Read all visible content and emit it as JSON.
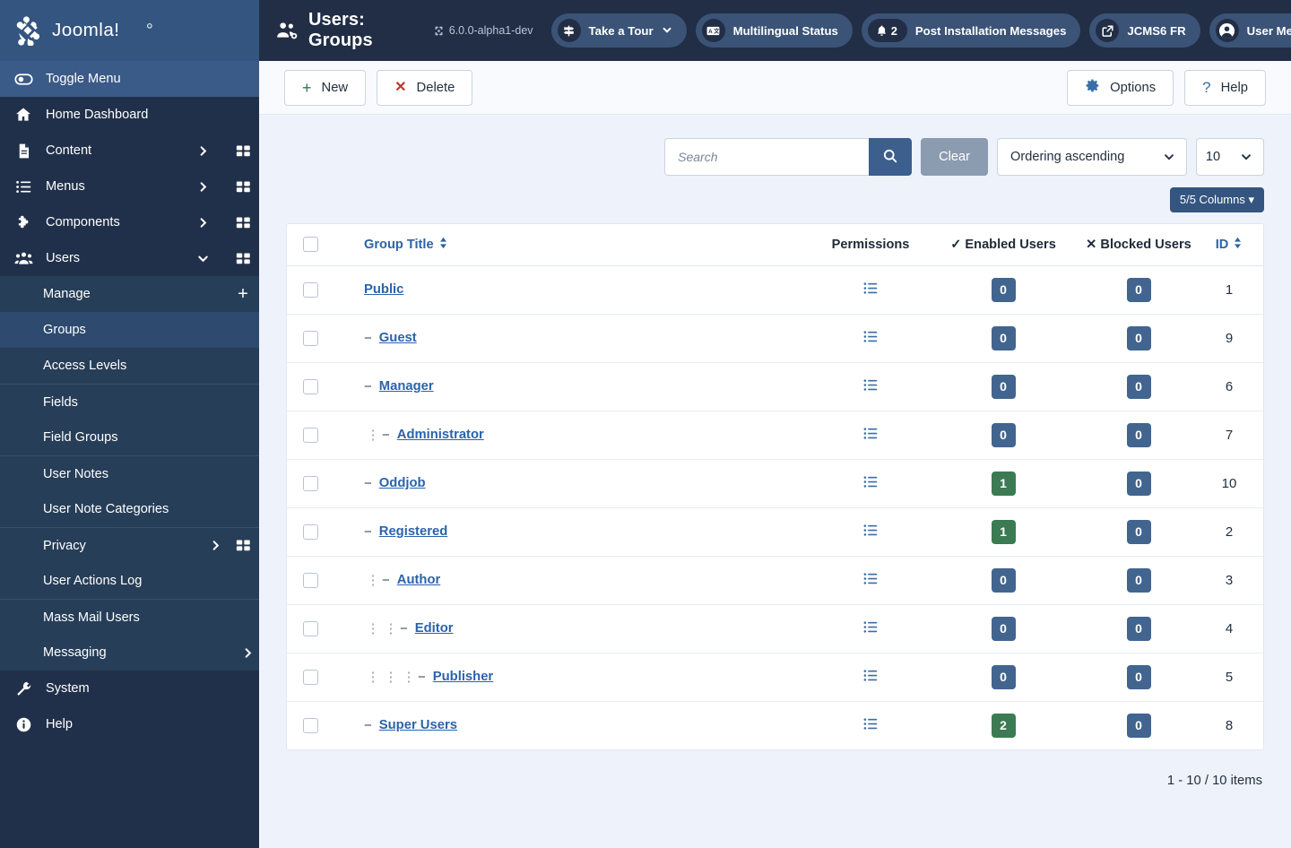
{
  "header": {
    "brand_name": "Joomla!",
    "page_title": "Users: Groups",
    "version": "6.0.0-alpha1-dev",
    "pills": [
      {
        "label": "Take a Tour",
        "icon": "signpost-icon",
        "chevron": "⌄",
        "count": null
      },
      {
        "label": "Multilingual Status",
        "icon": "translate-icon",
        "chevron": "",
        "count": null
      },
      {
        "label": "Post Installation Messages",
        "icon": "bell-icon",
        "chevron": "",
        "count": "2"
      },
      {
        "label": "JCMS6 FR",
        "icon": "external-link-icon",
        "chevron": "",
        "count": null
      },
      {
        "label": "User Menu",
        "icon": "user-circle-icon",
        "chevron": "⌄",
        "count": null
      }
    ]
  },
  "sidebar": {
    "toggle_label": "Toggle Menu",
    "items": [
      {
        "label": "Home Dashboard",
        "icon": "home-icon",
        "caret": "",
        "grid": false
      },
      {
        "label": "Content",
        "icon": "document-icon",
        "caret": "›",
        "grid": true
      },
      {
        "label": "Menus",
        "icon": "list-icon",
        "caret": "›",
        "grid": true
      },
      {
        "label": "Components",
        "icon": "puzzle-icon",
        "caret": "›",
        "grid": true
      },
      {
        "label": "Users",
        "icon": "users-icon",
        "caret": "⌄",
        "grid": true
      }
    ],
    "submenu": [
      {
        "label": "Manage",
        "active": false,
        "plus": true,
        "caret": "",
        "grid": false,
        "sep": false
      },
      {
        "label": "Groups",
        "active": true,
        "plus": false,
        "caret": "",
        "grid": false,
        "sep": false
      },
      {
        "label": "Access Levels",
        "active": false,
        "plus": false,
        "caret": "",
        "grid": false,
        "sep": false
      },
      {
        "label": "Fields",
        "active": false,
        "plus": false,
        "caret": "",
        "grid": false,
        "sep": true
      },
      {
        "label": "Field Groups",
        "active": false,
        "plus": false,
        "caret": "",
        "grid": false,
        "sep": false
      },
      {
        "label": "User Notes",
        "active": false,
        "plus": false,
        "caret": "",
        "grid": false,
        "sep": true
      },
      {
        "label": "User Note Categories",
        "active": false,
        "plus": false,
        "caret": "",
        "grid": false,
        "sep": false
      },
      {
        "label": "Privacy",
        "active": false,
        "plus": false,
        "caret": "›",
        "grid": true,
        "sep": true
      },
      {
        "label": "User Actions Log",
        "active": false,
        "plus": false,
        "caret": "",
        "grid": false,
        "sep": false
      },
      {
        "label": "Mass Mail Users",
        "active": false,
        "plus": false,
        "caret": "",
        "grid": false,
        "sep": true
      },
      {
        "label": "Messaging",
        "active": false,
        "plus": false,
        "caret": "›",
        "grid": false,
        "sep": false
      }
    ],
    "bottom_items": [
      {
        "label": "System",
        "icon": "wrench-icon"
      },
      {
        "label": "Help",
        "icon": "info-icon"
      }
    ]
  },
  "toolbar": {
    "new_label": "New",
    "delete_label": "Delete",
    "options_label": "Options",
    "help_label": "Help"
  },
  "filters": {
    "search_placeholder": "Search",
    "search_value": "",
    "clear_label": "Clear",
    "ordering_value": "Ordering ascending",
    "limit_value": "10",
    "columns_label": "5/5 Columns ▾"
  },
  "table": {
    "columns": {
      "group_title": "Group Title",
      "permissions": "Permissions",
      "enabled_users": "Enabled Users",
      "blocked_users": "Blocked Users",
      "id": "ID"
    },
    "rows": [
      {
        "title": "Public",
        "level": 0,
        "enabled": "0",
        "enabled_color": "blue",
        "blocked": "0",
        "blocked_color": "blue",
        "id": "1"
      },
      {
        "title": "Guest",
        "level": 1,
        "enabled": "0",
        "enabled_color": "blue",
        "blocked": "0",
        "blocked_color": "blue",
        "id": "9"
      },
      {
        "title": "Manager",
        "level": 1,
        "enabled": "0",
        "enabled_color": "blue",
        "blocked": "0",
        "blocked_color": "blue",
        "id": "6"
      },
      {
        "title": "Administrator",
        "level": 2,
        "enabled": "0",
        "enabled_color": "blue",
        "blocked": "0",
        "blocked_color": "blue",
        "id": "7"
      },
      {
        "title": "Oddjob",
        "level": 1,
        "enabled": "1",
        "enabled_color": "green",
        "blocked": "0",
        "blocked_color": "blue",
        "id": "10"
      },
      {
        "title": "Registered",
        "level": 1,
        "enabled": "1",
        "enabled_color": "green",
        "blocked": "0",
        "blocked_color": "blue",
        "id": "2"
      },
      {
        "title": "Author",
        "level": 2,
        "enabled": "0",
        "enabled_color": "blue",
        "blocked": "0",
        "blocked_color": "blue",
        "id": "3"
      },
      {
        "title": "Editor",
        "level": 3,
        "enabled": "0",
        "enabled_color": "blue",
        "blocked": "0",
        "blocked_color": "blue",
        "id": "4"
      },
      {
        "title": "Publisher",
        "level": 4,
        "enabled": "0",
        "enabled_color": "blue",
        "blocked": "0",
        "blocked_color": "blue",
        "id": "5"
      },
      {
        "title": "Super Users",
        "level": 1,
        "enabled": "2",
        "enabled_color": "green",
        "blocked": "0",
        "blocked_color": "blue",
        "id": "8"
      }
    ]
  },
  "pagination": {
    "summary": "1 - 10 / 10 items"
  },
  "colors": {
    "header_bg": "#212e45",
    "brand_bg": "#34557f",
    "sidebar_bg": "#21304a",
    "accent_link": "#2b63ab",
    "badge_blue": "#41658f",
    "badge_green": "#3b7a52",
    "search_btn": "#3c5f8d"
  }
}
